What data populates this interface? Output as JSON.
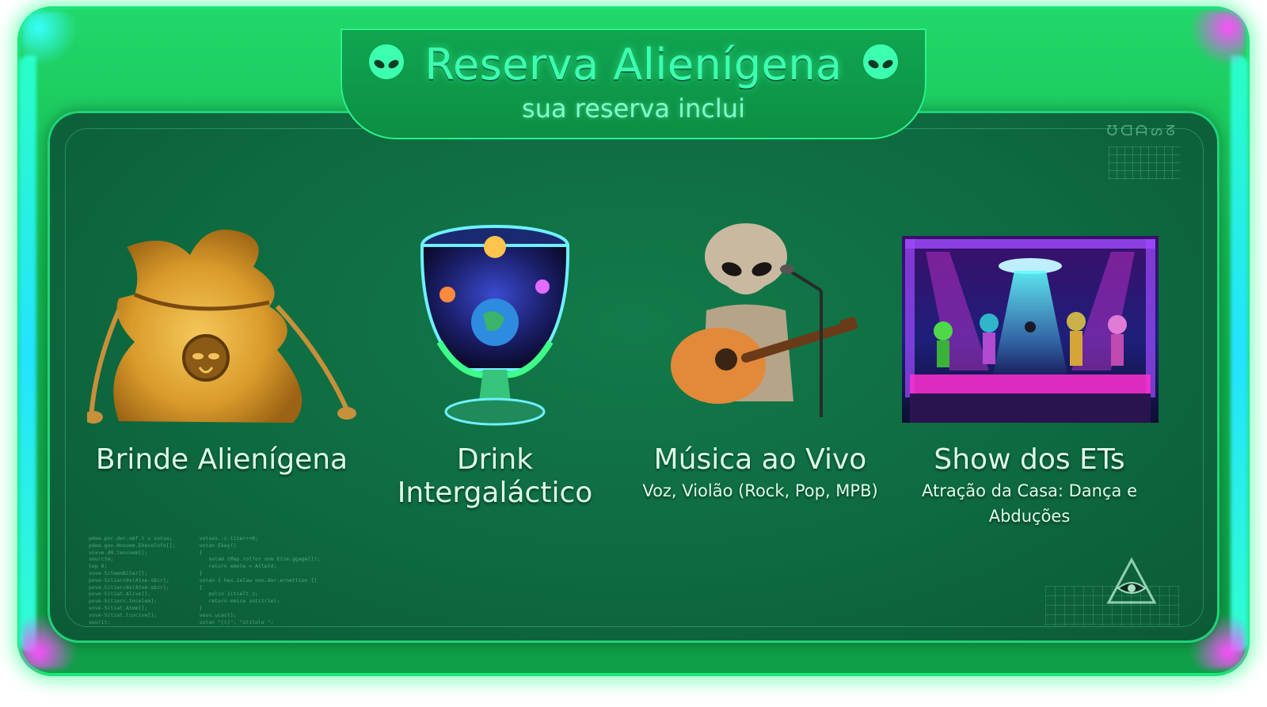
{
  "header": {
    "title": "Reserva Alienígena",
    "subtitle": "sua reserva inclui",
    "left_icon": "alien-head-icon",
    "right_icon": "alien-head-icon"
  },
  "items": [
    {
      "label": "Brinde Alienígena",
      "subtitle": "",
      "image": "golden-pouch-image"
    },
    {
      "label_line1": "Drink",
      "label_line2": "Intergaláctico",
      "subtitle": "",
      "image": "cosmic-goblet-image"
    },
    {
      "label": "Música ao Vivo",
      "subtitle": "Voz, Violão (Rock, Pop, MPB)",
      "image": "alien-guitarist-image"
    },
    {
      "label": "Show dos ETs",
      "subtitle_line1": "Atração da Casa: Dança e",
      "subtitle_line2": "Abduções",
      "image": "alien-stage-show-image"
    }
  ],
  "decor": {
    "corner_glyphs": "ᘮᗡᗩᔕᘔ",
    "bottom_right_icon": "eye-of-providence-icon"
  },
  "colors": {
    "frame": "#13b84f",
    "panel": "#0e6a3f",
    "title": "#3dffb0",
    "label": "#dcffe9",
    "accent_cyan": "#23e3ff",
    "accent_magenta": "#ff4dff"
  }
}
